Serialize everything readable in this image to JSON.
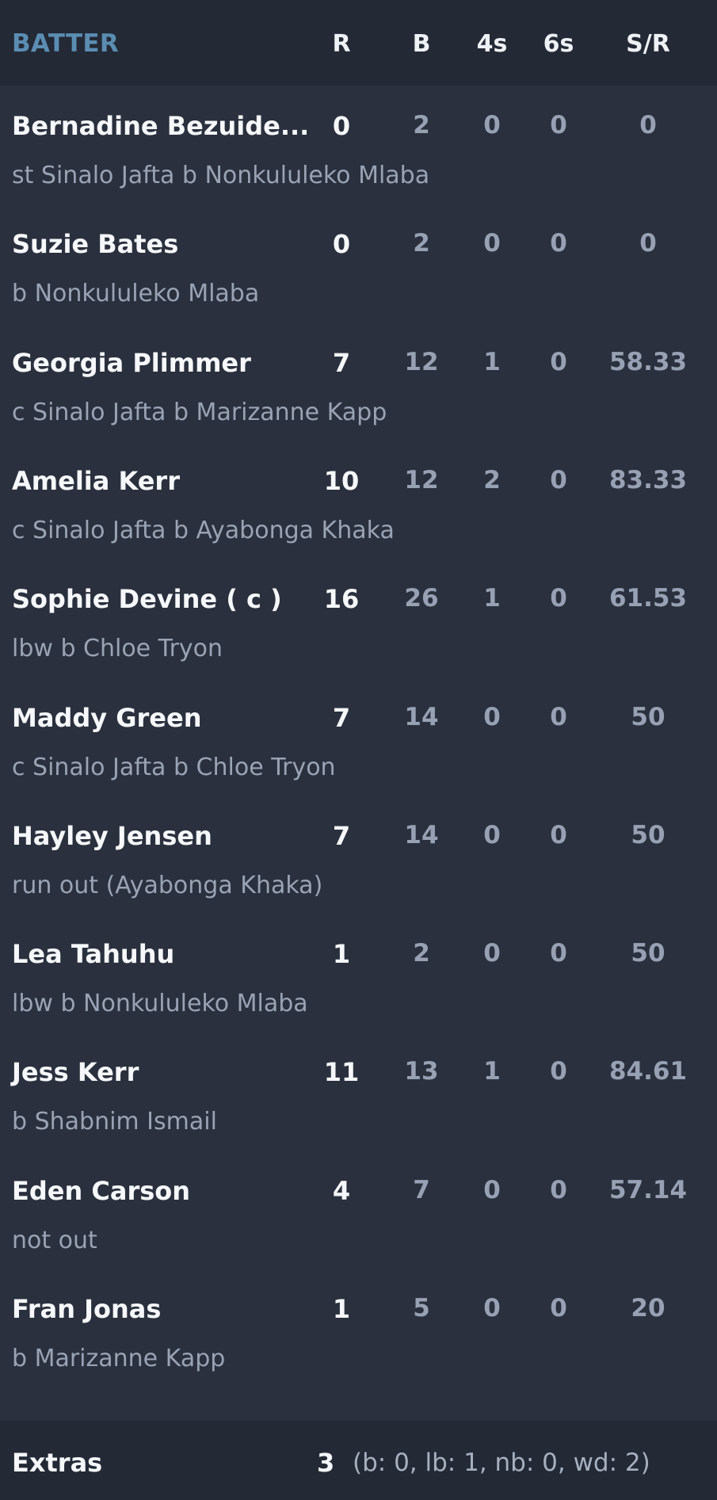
{
  "header": {
    "batter": "BATTER",
    "r": "R",
    "b": "B",
    "fours": "4s",
    "sixes": "6s",
    "sr": "S/R"
  },
  "batters": [
    {
      "name": "Bernadine Bezuide...",
      "dismissal": "st Sinalo Jafta b Nonkululeko Mlaba",
      "r": "0",
      "b": "2",
      "fours": "0",
      "sixes": "0",
      "sr": "0"
    },
    {
      "name": "Suzie Bates",
      "dismissal": "b Nonkululeko Mlaba",
      "r": "0",
      "b": "2",
      "fours": "0",
      "sixes": "0",
      "sr": "0"
    },
    {
      "name": "Georgia Plimmer",
      "dismissal": "c Sinalo Jafta b Marizanne Kapp",
      "r": "7",
      "b": "12",
      "fours": "1",
      "sixes": "0",
      "sr": "58.33"
    },
    {
      "name": "Amelia Kerr",
      "dismissal": "c Sinalo Jafta b Ayabonga Khaka",
      "r": "10",
      "b": "12",
      "fours": "2",
      "sixes": "0",
      "sr": "83.33"
    },
    {
      "name": "Sophie Devine ( c )",
      "dismissal": "lbw b Chloe Tryon",
      "r": "16",
      "b": "26",
      "fours": "1",
      "sixes": "0",
      "sr": "61.53"
    },
    {
      "name": "Maddy Green",
      "dismissal": "c Sinalo Jafta b Chloe Tryon",
      "r": "7",
      "b": "14",
      "fours": "0",
      "sixes": "0",
      "sr": "50"
    },
    {
      "name": "Hayley Jensen",
      "dismissal": "run out (Ayabonga Khaka)",
      "r": "7",
      "b": "14",
      "fours": "0",
      "sixes": "0",
      "sr": "50"
    },
    {
      "name": "Lea Tahuhu",
      "dismissal": "lbw b Nonkululeko Mlaba",
      "r": "1",
      "b": "2",
      "fours": "0",
      "sixes": "0",
      "sr": "50"
    },
    {
      "name": "Jess Kerr",
      "dismissal": "b Shabnim Ismail",
      "r": "11",
      "b": "13",
      "fours": "1",
      "sixes": "0",
      "sr": "84.61"
    },
    {
      "name": "Eden Carson",
      "dismissal": "not out",
      "r": "4",
      "b": "7",
      "fours": "0",
      "sixes": "0",
      "sr": "57.14"
    },
    {
      "name": "Fran Jonas",
      "dismissal": "b Marizanne Kapp",
      "r": "1",
      "b": "5",
      "fours": "0",
      "sixes": "0",
      "sr": "20"
    }
  ],
  "extras": {
    "label": "Extras",
    "total": "3",
    "detail": "(b: 0, lb: 1, nb: 0, wd: 2)"
  }
}
